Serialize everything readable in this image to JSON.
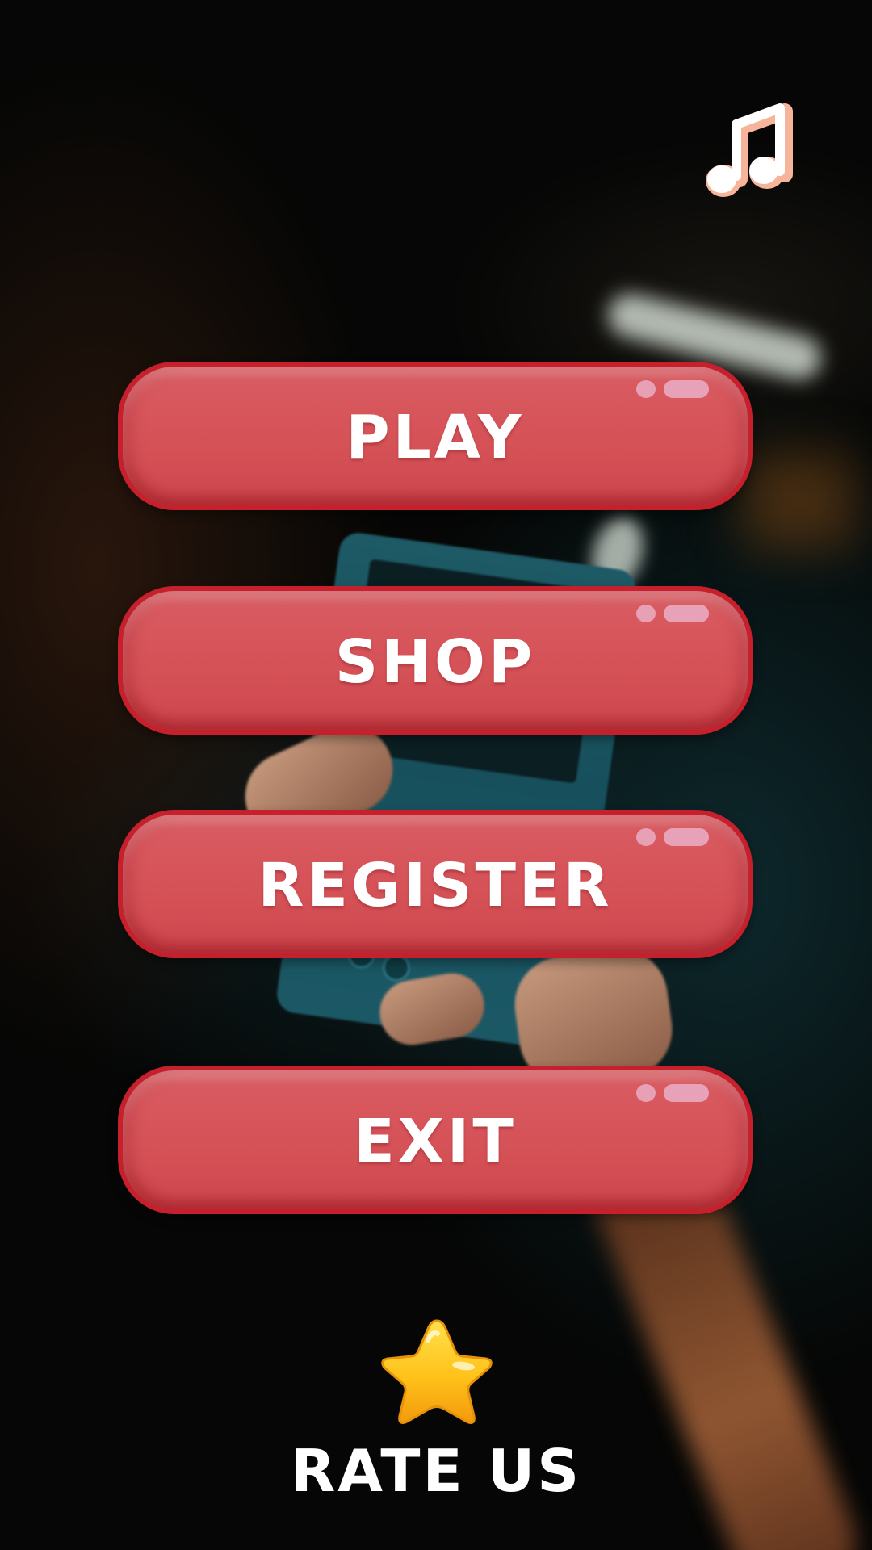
{
  "menu": {
    "play_label": "PLAY",
    "shop_label": "SHOP",
    "register_label": "REGISTER",
    "exit_label": "EXIT"
  },
  "rate": {
    "label": "RATE US",
    "icon": "star-icon"
  },
  "music": {
    "icon": "music-note-icon"
  },
  "colors": {
    "button_fill": "#d55257",
    "button_border": "#c6202c",
    "button_text": "#ffffff",
    "star": "#ffc21a"
  }
}
